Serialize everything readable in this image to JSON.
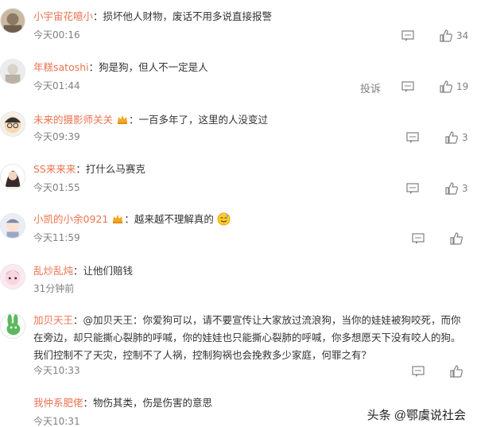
{
  "comments": [
    {
      "name": "小宇宙花噫小",
      "sep": "：",
      "text": "损坏他人财物，废话不用多说直接报警",
      "time": "今天00:16",
      "likes": "34"
    },
    {
      "name": "年糕satoshi",
      "sep": "：",
      "text": "狗是狗，但人不一定是人",
      "time": "今天01:44",
      "likes": "19",
      "report": "投诉"
    },
    {
      "name": "未来的摄影师关关",
      "sep": "：",
      "text": "一百多年了，这里的人没变过",
      "time": "今天09:39",
      "likes": "3"
    },
    {
      "name": "SS来来来",
      "sep": "：",
      "text": "打什么马赛克",
      "time": "今天01:55",
      "likes": "3"
    },
    {
      "name": "小凯的小余0921",
      "sep": "：",
      "text": "越来越不理解真的",
      "time": "今天11:59",
      "likes": ""
    },
    {
      "name": "乱炒乱炖",
      "sep": "：",
      "text": "让他们赔钱",
      "time": "31分钟前",
      "likes": ""
    },
    {
      "name": "加贝天王",
      "sep": "：",
      "text": "@加贝天王：你爱狗可以，请不要宣传让大家放过流浪狗，当你的娃娃被狗咬死，而你在旁边，却只能撕心裂肺的呼喊，你的娃娃也只能撕心裂肺的呼喊，你多想愿天下没有咬人的狗。我们控制不了天灾，控制不了人祸，控制狗祸也会挽救多少家庭，何罪之有？",
      "time": "今天10:33",
      "likes": ""
    },
    {
      "name": "我仲系肥佬",
      "sep": "：",
      "text": "物伤其类，伤是伤害的意思",
      "time": "今天10:31",
      "likes": ""
    }
  ],
  "watermark": "头条 @鄂虞说社会",
  "colors": {
    "name": "#eb7350",
    "text": "#333333",
    "meta": "#808080"
  }
}
